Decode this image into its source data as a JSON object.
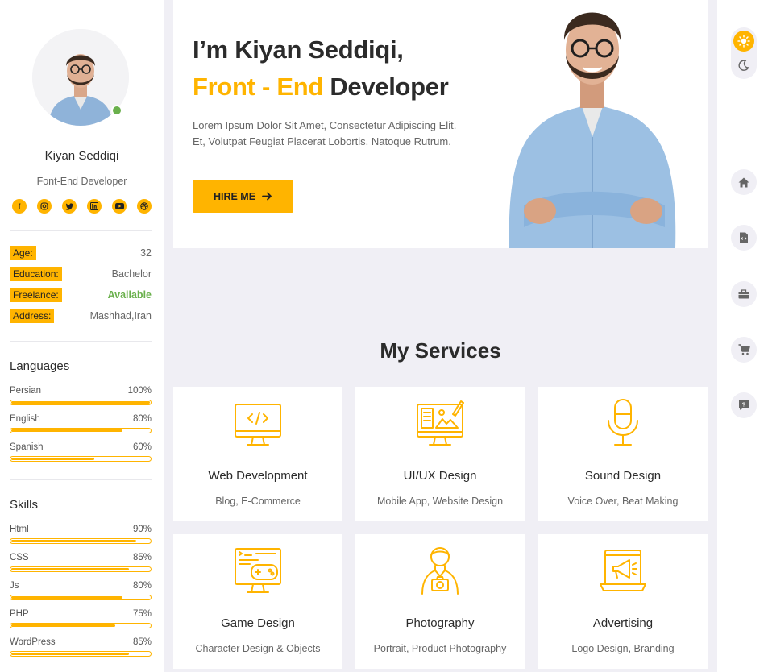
{
  "profile": {
    "name": "Kiyan Seddiqi",
    "role": "Font-End Developer",
    "socials": [
      "facebook-icon",
      "instagram-icon",
      "twitter-icon",
      "linkedin-icon",
      "youtube-icon",
      "dribbble-icon"
    ]
  },
  "info": [
    {
      "key": "Age:",
      "value": "32"
    },
    {
      "key": "Education:",
      "value": "Bachelor"
    },
    {
      "key": "Freelance:",
      "value": "Available"
    },
    {
      "key": "Address:",
      "value": "Mashhad,Iran"
    }
  ],
  "languages": {
    "title": "Languages",
    "items": [
      {
        "name": "Persian",
        "percent_label": "100%",
        "level": 1.0
      },
      {
        "name": "English",
        "percent_label": "80%",
        "level": 0.8
      },
      {
        "name": "Spanish",
        "percent_label": "60%",
        "level": 0.6
      }
    ]
  },
  "skills": {
    "title": "Skills",
    "items": [
      {
        "name": "Html",
        "percent_label": "90%",
        "level": 0.9
      },
      {
        "name": "CSS",
        "percent_label": "85%",
        "level": 0.85
      },
      {
        "name": "Js",
        "percent_label": "80%",
        "level": 0.8
      },
      {
        "name": "PHP",
        "percent_label": "75%",
        "level": 0.75
      },
      {
        "name": "WordPress",
        "percent_label": "85%",
        "level": 0.85
      }
    ]
  },
  "hero": {
    "line1": "I’m Kiyan Seddiqi,",
    "accent": "Front - End",
    "line2_rest": " Developer",
    "description": "Lorem Ipsum Dolor Sit Amet, Consectetur Adipiscing Elit. Et, Volutpat Feugiat Placerat Lobortis. Natoque Rutrum.",
    "button_label": "HIRE ME"
  },
  "services": {
    "title": "My Services",
    "items": [
      {
        "title": "Web Development",
        "subtitle": "Blog, E-Commerce",
        "icon": "monitor-code-icon"
      },
      {
        "title": "UI/UX Design",
        "subtitle": "Mobile App, Website Design",
        "icon": "design-monitor-icon"
      },
      {
        "title": "Sound Design",
        "subtitle": "Voice Over, Beat Making",
        "icon": "microphone-icon"
      },
      {
        "title": "Game Design",
        "subtitle": "Character Design & Objects",
        "icon": "gamepad-monitor-icon"
      },
      {
        "title": "Photography",
        "subtitle": "Portrait, Product Photography",
        "icon": "photographer-icon"
      },
      {
        "title": "Advertising",
        "subtitle": "Logo Design, Branding",
        "icon": "megaphone-laptop-icon"
      }
    ]
  },
  "rail": {
    "icons": [
      "home-icon",
      "file-code-icon",
      "briefcase-icon",
      "cart-icon",
      "help-icon"
    ]
  },
  "colors": {
    "accent": "#ffb400",
    "online": "#6ab04c",
    "background": "#f0eff5"
  }
}
